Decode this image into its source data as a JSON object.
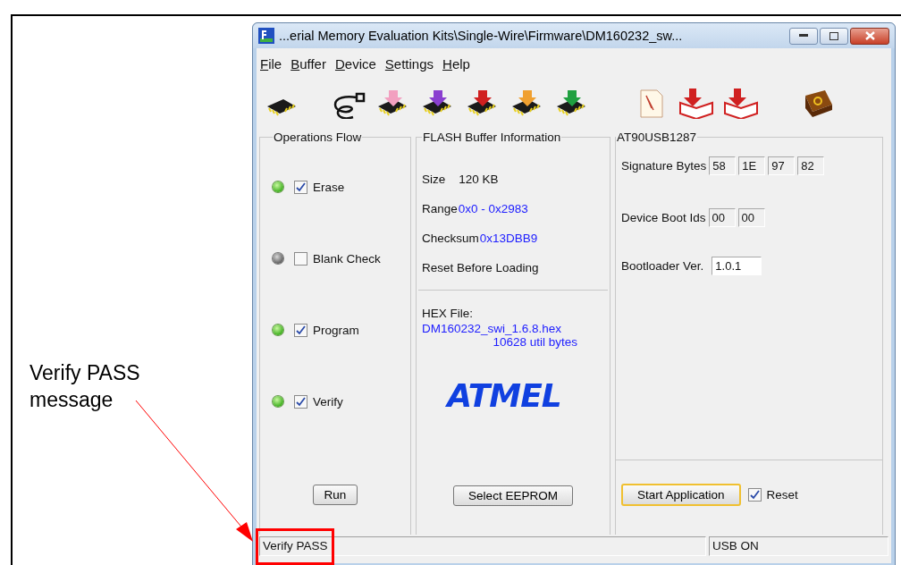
{
  "window": {
    "title": "...erial Memory Evaluation Kits\\Single-Wire\\Firmware\\DM160232_sw..."
  },
  "menu": [
    "File",
    "Buffer",
    "Device",
    "Settings",
    "Help"
  ],
  "operations": {
    "title": "Operations Flow",
    "steps": [
      {
        "label": "Erase",
        "checked": true,
        "led_on": true
      },
      {
        "label": "Blank Check",
        "checked": false,
        "led_on": false
      },
      {
        "label": "Program",
        "checked": true,
        "led_on": true
      },
      {
        "label": "Verify",
        "checked": true,
        "led_on": true
      }
    ],
    "button": "Run"
  },
  "flash": {
    "title": "FLASH Buffer Information",
    "rows": [
      {
        "label": "Size",
        "value": "120 KB",
        "highlighted": false
      },
      {
        "label": "Range",
        "value": "0x0 - 0x2983",
        "highlighted": true
      },
      {
        "label": "Checksum",
        "value": "0x13DBB9",
        "highlighted": true
      }
    ],
    "reset_text": "Reset Before Loading",
    "hex_label": "HEX File:",
    "hex_file": "DM160232_swi_1.6.8.hex",
    "hex_bytes": "10628 util bytes",
    "logo": "ATMEL",
    "button": "Select EEPROM"
  },
  "device": {
    "title": "AT90USB1287",
    "signature_label": "Signature Bytes",
    "signature_bytes": [
      "58",
      "1E",
      "97",
      "82"
    ],
    "boot_ids_label": "Device Boot Ids",
    "boot_ids": [
      "00",
      "00"
    ],
    "bootloader_label": "Bootloader Ver.",
    "bootloader_version": "1.0.1",
    "button": "Start Application",
    "reset": {
      "label": "Reset",
      "checked": true
    }
  },
  "status_bar": [
    "Verify PASS",
    "USB ON"
  ],
  "annotation": "Verify PASS message"
}
